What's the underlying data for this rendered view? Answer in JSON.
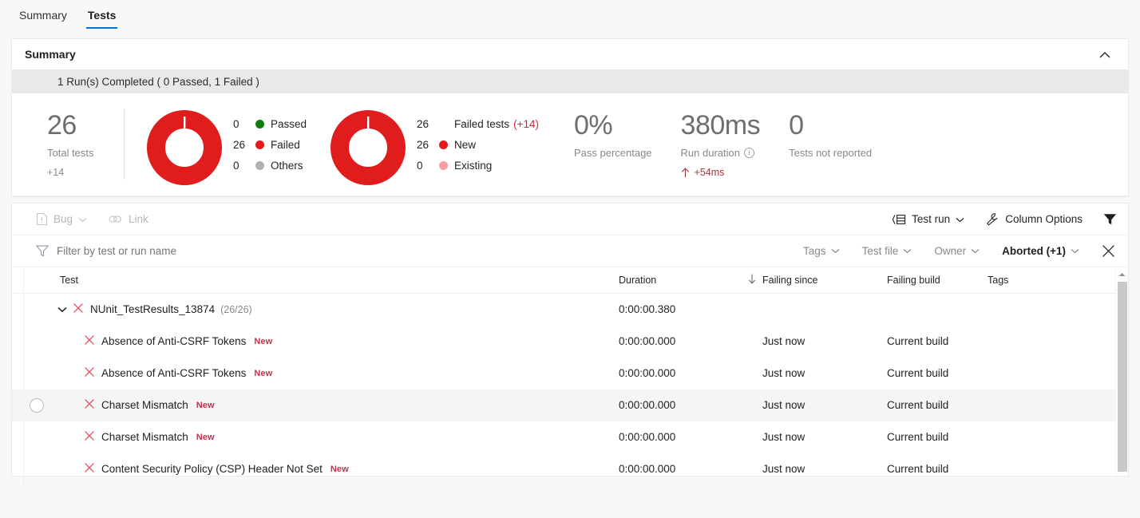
{
  "tabs": [
    {
      "label": "Summary",
      "active": false
    },
    {
      "label": "Tests",
      "active": true
    }
  ],
  "summary": {
    "title": "Summary",
    "banner": "1 Run(s) Completed ( 0 Passed, 1 Failed )",
    "collapse_icon": "chevron-up-icon",
    "total": {
      "value": "26",
      "label": "Total tests",
      "delta": "+14"
    },
    "outcome_chart": {
      "legend": [
        {
          "count": "0",
          "label": "Passed",
          "color": "#107c10"
        },
        {
          "count": "26",
          "label": "Failed",
          "color": "#e01c1c"
        },
        {
          "count": "0",
          "label": "Others",
          "color": "#b3b0ad"
        }
      ]
    },
    "failed_chart": {
      "heading_count": "26",
      "heading_label": "Failed tests",
      "heading_delta": "(+14)",
      "legend": [
        {
          "count": "26",
          "label": "New",
          "color": "#e01c1c"
        },
        {
          "count": "0",
          "label": "Existing",
          "color": "#f4a0a0"
        }
      ]
    },
    "metrics": [
      {
        "value": "0%",
        "label": "Pass percentage",
        "info": false,
        "trend": null
      },
      {
        "value": "380ms",
        "label": "Run duration",
        "info": true,
        "trend": "+54ms"
      },
      {
        "value": "0",
        "label": "Tests not reported",
        "info": false,
        "trend": null
      }
    ]
  },
  "toolbar": {
    "bug_label": "Bug",
    "link_label": "Link",
    "test_run_label": "Test run",
    "column_options_label": "Column Options",
    "filter_icon": "funnel-filled-icon"
  },
  "filterbar": {
    "placeholder": "Filter by test or run name",
    "value": "",
    "dropdowns": [
      {
        "label": "Tags",
        "active": false
      },
      {
        "label": "Test file",
        "active": false
      },
      {
        "label": "Owner",
        "active": false
      },
      {
        "label": "Aborted (+1)",
        "active": true
      }
    ],
    "close_icon": "close-icon"
  },
  "table": {
    "columns": [
      {
        "key": "test",
        "label": "Test"
      },
      {
        "key": "dur",
        "label": "Duration"
      },
      {
        "key": "since",
        "label": "Failing since",
        "sorted": true,
        "sort_dir": "desc"
      },
      {
        "key": "build",
        "label": "Failing build"
      },
      {
        "key": "tags",
        "label": "Tags"
      }
    ],
    "rows": [
      {
        "type": "group",
        "expanded": true,
        "name": "NUnit_TestResults_13874",
        "count": "(26/26)",
        "duration": "0:00:00.380",
        "failing_since": "",
        "failing_build": "",
        "tags": "",
        "badge": "",
        "hover": false
      },
      {
        "type": "test",
        "name": "Absence of Anti-CSRF Tokens",
        "badge": "New",
        "duration": "0:00:00.000",
        "failing_since": "Just now",
        "failing_build": "Current build",
        "tags": "",
        "hover": false
      },
      {
        "type": "test",
        "name": "Absence of Anti-CSRF Tokens",
        "badge": "New",
        "duration": "0:00:00.000",
        "failing_since": "Just now",
        "failing_build": "Current build",
        "tags": "",
        "hover": false
      },
      {
        "type": "test",
        "name": "Charset Mismatch",
        "badge": "New",
        "duration": "0:00:00.000",
        "failing_since": "Just now",
        "failing_build": "Current build",
        "tags": "",
        "hover": true
      },
      {
        "type": "test",
        "name": "Charset Mismatch",
        "badge": "New",
        "duration": "0:00:00.000",
        "failing_since": "Just now",
        "failing_build": "Current build",
        "tags": "",
        "hover": false
      },
      {
        "type": "test",
        "name": "Content Security Policy (CSP) Header Not Set",
        "badge": "New",
        "duration": "0:00:00.000",
        "failing_since": "Just now",
        "failing_build": "Current build",
        "tags": "",
        "hover": false
      }
    ]
  },
  "colors": {
    "accent": "#0078d4",
    "fail_red": "#e01c1c",
    "pass_green": "#107c10",
    "other_gray": "#b3b0ad",
    "new_badge": "#c4314b",
    "delta_red": "#cc2936",
    "x_icon": "#e74856"
  }
}
